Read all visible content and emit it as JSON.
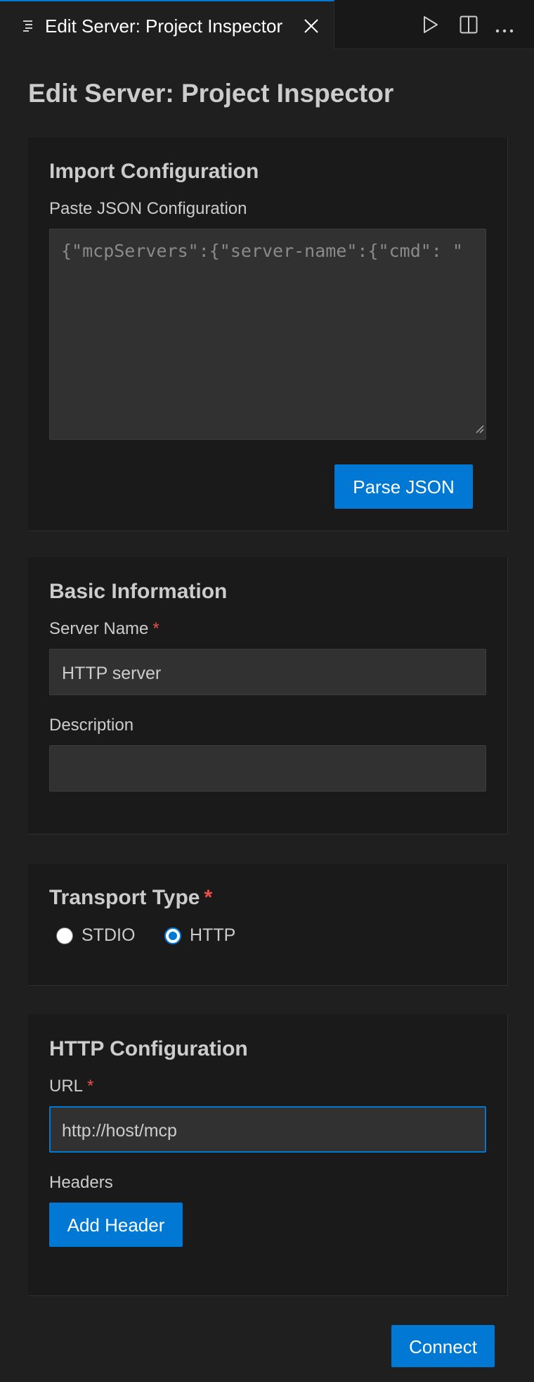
{
  "tab": {
    "title": "Edit Server: Project Inspector"
  },
  "page": {
    "title": "Edit Server: Project Inspector"
  },
  "import": {
    "title": "Import Configuration",
    "json_label": "Paste JSON Configuration",
    "json_placeholder": "{\"mcpServers\":{\"server-name\":{\"cmd\": \"",
    "parse_button": "Parse JSON"
  },
  "basic": {
    "title": "Basic Information",
    "name_label": "Server Name",
    "name_value": "HTTP server",
    "description_label": "Description",
    "description_value": "",
    "required_mark": "*"
  },
  "transport": {
    "title": "Transport Type",
    "required_mark": "*",
    "options": [
      {
        "label": "STDIO",
        "selected": false
      },
      {
        "label": "HTTP",
        "selected": true
      }
    ]
  },
  "http": {
    "title": "HTTP Configuration",
    "url_label": "URL",
    "required_mark": "*",
    "url_value": "http://host/mcp",
    "headers_label": "Headers",
    "add_header_button": "Add Header"
  },
  "connect_button": "Connect",
  "colors": {
    "accent": "#0078d4",
    "required": "#f14c4c",
    "background": "#1f1f1f"
  }
}
